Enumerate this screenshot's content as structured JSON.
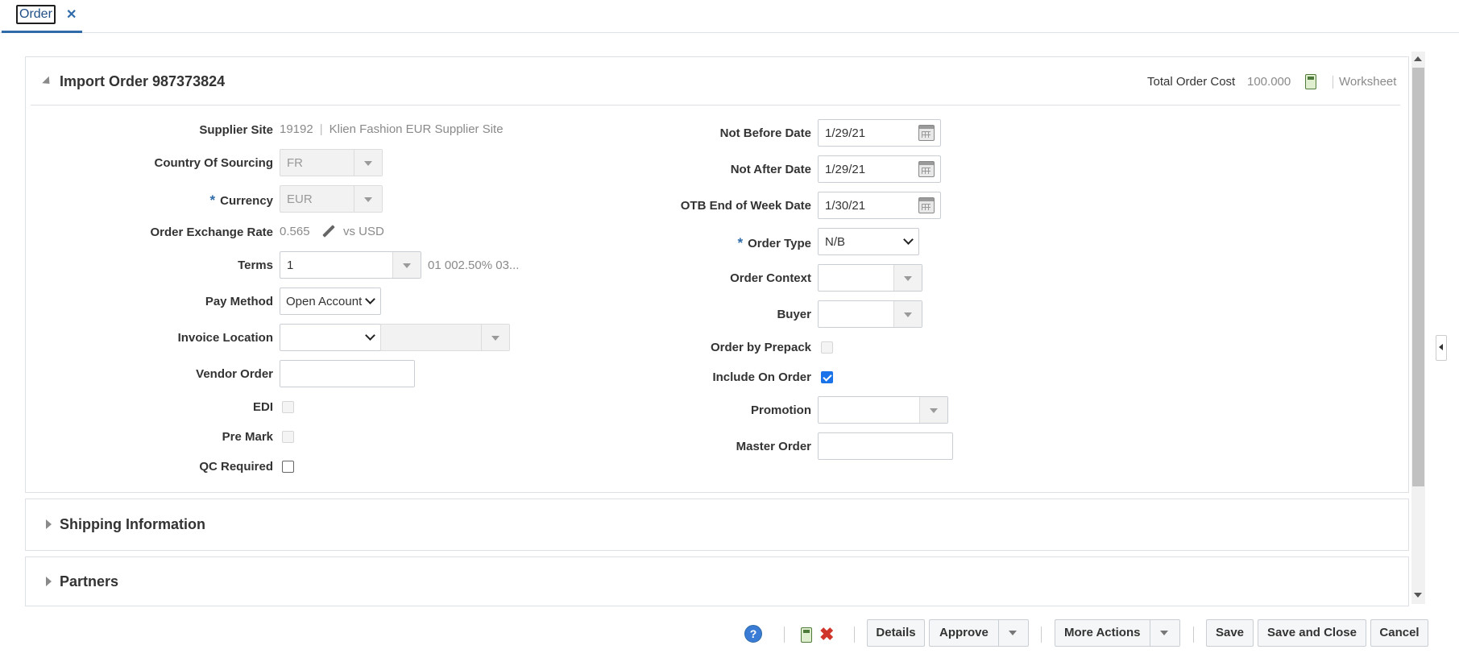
{
  "tab": {
    "label": "Order",
    "close_glyph": "✕"
  },
  "header": {
    "title": "Import Order 987373824",
    "total_cost_label": "Total Order Cost",
    "total_cost_value": "100.000",
    "worksheet": "Worksheet"
  },
  "left": {
    "supplier_site_label": "Supplier Site",
    "supplier_site_id": "19192",
    "supplier_site_name": "Klien Fashion EUR Supplier Site",
    "country_label": "Country Of Sourcing",
    "country_value": "FR",
    "currency_label": "Currency",
    "currency_value": "EUR",
    "exchange_label": "Order Exchange Rate",
    "exchange_value": "0.565",
    "exchange_vs": "vs USD",
    "terms_label": "Terms",
    "terms_value": "1",
    "terms_desc": "01 002.50% 03...",
    "pay_method_label": "Pay Method",
    "pay_method_value": "Open Account",
    "invoice_label": "Invoice Location",
    "vendor_order_label": "Vendor Order",
    "edi_label": "EDI",
    "pre_mark_label": "Pre Mark",
    "qc_label": "QC Required"
  },
  "right": {
    "not_before_label": "Not Before Date",
    "not_before_value": "1/29/21",
    "not_after_label": "Not After Date",
    "not_after_value": "1/29/21",
    "otb_label": "OTB End of Week Date",
    "otb_value": "1/30/21",
    "order_type_label": "Order Type",
    "order_type_value": "N/B",
    "order_context_label": "Order Context",
    "buyer_label": "Buyer",
    "prepack_label": "Order by Prepack",
    "include_label": "Include On Order",
    "include_checked": true,
    "promotion_label": "Promotion",
    "master_label": "Master Order"
  },
  "required_marker": "*",
  "sections": {
    "shipping": "Shipping Information",
    "partners": "Partners"
  },
  "footer": {
    "help": "?",
    "details": "Details",
    "approve": "Approve",
    "more_actions": "More Actions",
    "save": "Save",
    "save_close": "Save and Close",
    "cancel": "Cancel"
  },
  "colors": {
    "accent": "#2f6ba8",
    "checkbox": "#1a73e8",
    "delete": "#d0352b"
  }
}
